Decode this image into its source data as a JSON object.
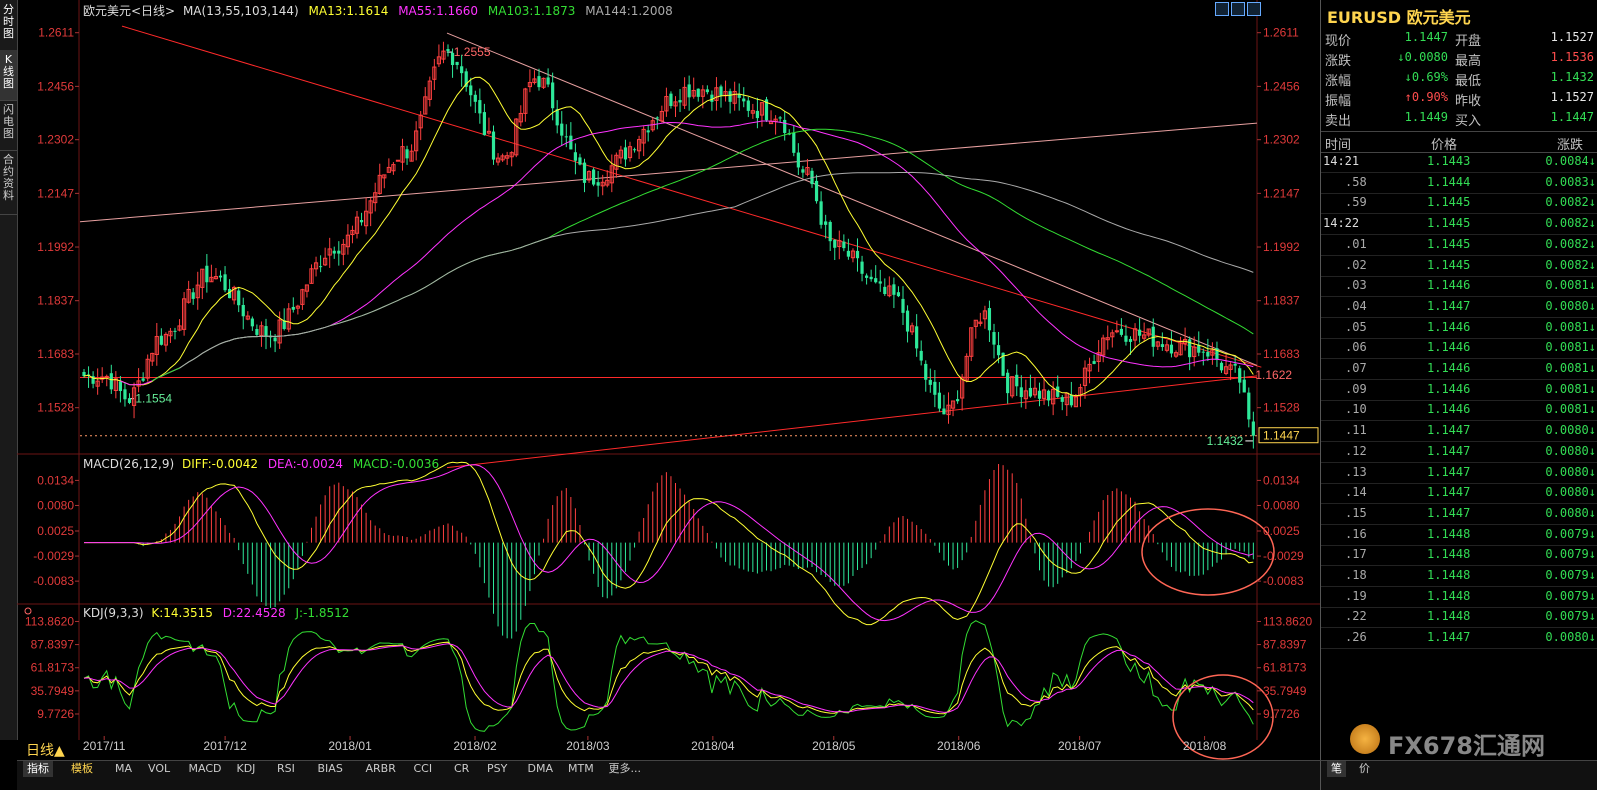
{
  "left_tabs": [
    "分时图",
    "K线图",
    "闪电图",
    "合约资料"
  ],
  "chart_header": {
    "symbol": "欧元美元<日线>",
    "ma_label": "MA(13,55,103,144)",
    "ma13": "MA13:1.1614",
    "ma55": "MA55:1.1660",
    "ma103": "MA103:1.1873",
    "ma144": "MA144:1.2008"
  },
  "macd_header": {
    "name": "MACD(26,12,9)",
    "diff": "DIFF:-0.0042",
    "dea": "DEA:-0.0024",
    "macd": "MACD:-0.0036"
  },
  "kdj_header": {
    "name": "KDJ(9,3,3)",
    "k": "K:14.3515",
    "d": "D:22.4528",
    "j": "J:-1.8512"
  },
  "period_label": "日线▲",
  "annotations": {
    "high": "1.2555",
    "low_left": "1.1554",
    "recent_high": "1.1622",
    "recent_low": "1.1432",
    "current_price": "1.1447"
  },
  "colors": {
    "up": "#ff4040",
    "down": "#2ee89a",
    "ma13": "#ffff33",
    "ma55": "#ff33ff",
    "ma103": "#33dd33",
    "ma144": "#aaaaaa",
    "axis_text": "#e03a3a",
    "trendline": "#ff2a2a",
    "resistance": "#e8a0a0",
    "highlight_circle": "#ff6655"
  },
  "bottom_tabs": [
    "指标",
    "模板",
    "MA",
    "VOL",
    "MACD",
    "KDJ",
    "RSI",
    "BIAS",
    "ARBR",
    "CCI",
    "CR",
    "PSY",
    "DMA",
    "MTM",
    "更多..."
  ],
  "right_panel": {
    "title": "EURUSD 欧元美元",
    "quote": [
      {
        "l1": "现价",
        "v1": "1.1447",
        "c1": "dn",
        "l2": "开盘",
        "v2": "1.1527",
        "c2": "val"
      },
      {
        "l1": "涨跌",
        "v1": "↓0.0080",
        "c1": "dn",
        "l2": "最高",
        "v2": "1.1536",
        "c2": "up"
      },
      {
        "l1": "涨幅",
        "v1": "↓0.69%",
        "c1": "dn",
        "l2": "最低",
        "v2": "1.1432",
        "c2": "dn"
      },
      {
        "l1": "振幅",
        "v1": "↑0.90%",
        "c1": "up",
        "l2": "昨收",
        "v2": "1.1527",
        "c2": "val"
      },
      {
        "l1": "卖出",
        "v1": "1.1449",
        "c1": "dn",
        "l2": "买入",
        "v2": "1.1447",
        "c2": "dn"
      }
    ],
    "tick_header": [
      "时间",
      "价格",
      "涨跌"
    ],
    "ticks": [
      {
        "t": "14:21",
        "p": "1.1443",
        "c": "0.0084"
      },
      {
        "t": ".58",
        "p": "1.1444",
        "c": "0.0083"
      },
      {
        "t": ".59",
        "p": "1.1445",
        "c": "0.0082"
      },
      {
        "t": "14:22",
        "p": "1.1445",
        "c": "0.0082"
      },
      {
        "t": ".01",
        "p": "1.1445",
        "c": "0.0082"
      },
      {
        "t": ".02",
        "p": "1.1445",
        "c": "0.0082"
      },
      {
        "t": ".03",
        "p": "1.1446",
        "c": "0.0081"
      },
      {
        "t": ".04",
        "p": "1.1447",
        "c": "0.0080"
      },
      {
        "t": ".05",
        "p": "1.1446",
        "c": "0.0081"
      },
      {
        "t": ".06",
        "p": "1.1446",
        "c": "0.0081"
      },
      {
        "t": ".07",
        "p": "1.1446",
        "c": "0.0081"
      },
      {
        "t": ".09",
        "p": "1.1446",
        "c": "0.0081"
      },
      {
        "t": ".10",
        "p": "1.1446",
        "c": "0.0081"
      },
      {
        "t": ".11",
        "p": "1.1447",
        "c": "0.0080"
      },
      {
        "t": ".12",
        "p": "1.1447",
        "c": "0.0080"
      },
      {
        "t": ".13",
        "p": "1.1447",
        "c": "0.0080"
      },
      {
        "t": ".14",
        "p": "1.1447",
        "c": "0.0080"
      },
      {
        "t": ".15",
        "p": "1.1447",
        "c": "0.0080"
      },
      {
        "t": ".16",
        "p": "1.1448",
        "c": "0.0079"
      },
      {
        "t": ".17",
        "p": "1.1448",
        "c": "0.0079"
      },
      {
        "t": ".18",
        "p": "1.1448",
        "c": "0.0079"
      },
      {
        "t": ".19",
        "p": "1.1448",
        "c": "0.0079"
      },
      {
        "t": ".22",
        "p": "1.1448",
        "c": "0.0079"
      },
      {
        "t": ".26",
        "p": "1.1447",
        "c": "0.0080"
      }
    ],
    "bottom_tabs": [
      "笔",
      "价"
    ]
  },
  "watermark": "FX678汇通网",
  "chart_data": [
    {
      "type": "candlestick",
      "title": "欧元美元<日线>",
      "y_ticks": [
        1.2611,
        1.2456,
        1.2302,
        1.2147,
        1.1992,
        1.1837,
        1.1683,
        1.1528
      ],
      "ylim": [
        1.14,
        1.2665
      ],
      "x_ticks": [
        "2017/11",
        "2017/12",
        "2018/01",
        "2018/02",
        "2018/03",
        "2018/04",
        "2018/05",
        "2018/06",
        "2018/07",
        "2018/08"
      ],
      "close_path": [
        {
          "x": "2017/11/01",
          "y": 1.162
        },
        {
          "x": "2017/11/07",
          "y": 1.1554
        },
        {
          "x": "2017/11/15",
          "y": 1.173
        },
        {
          "x": "2017/11/27",
          "y": 1.191
        },
        {
          "x": "2017/12/12",
          "y": 1.174
        },
        {
          "x": "2017/12/29",
          "y": 1.2
        },
        {
          "x": "2018/01/15",
          "y": 1.227
        },
        {
          "x": "2018/01/25",
          "y": 1.2555
        },
        {
          "x": "2018/02/08",
          "y": 1.225
        },
        {
          "x": "2018/02/16",
          "y": 1.248
        },
        {
          "x": "2018/03/01",
          "y": 1.219
        },
        {
          "x": "2018/03/27",
          "y": 1.245
        },
        {
          "x": "2018/04/17",
          "y": 1.238
        },
        {
          "x": "2018/04/24",
          "y": 1.22
        },
        {
          "x": "2018/05/01",
          "y": 1.199
        },
        {
          "x": "2018/05/15",
          "y": 1.185
        },
        {
          "x": "2018/05/29",
          "y": 1.151
        },
        {
          "x": "2018/06/07",
          "y": 1.18
        },
        {
          "x": "2018/06/14",
          "y": 1.159
        },
        {
          "x": "2018/06/28",
          "y": 1.155
        },
        {
          "x": "2018/07/09",
          "y": 1.175
        },
        {
          "x": "2018/07/31",
          "y": 1.17
        },
        {
          "x": "2018/08/09",
          "y": 1.1622
        },
        {
          "x": "2018/08/13",
          "y": 1.1447
        }
      ],
      "moving_averages": [
        {
          "name": "MA13",
          "last": 1.1614
        },
        {
          "name": "MA55",
          "last": 1.166
        },
        {
          "name": "MA103",
          "last": 1.1873
        },
        {
          "name": "MA144",
          "last": 1.2008
        }
      ]
    },
    {
      "type": "line",
      "title": "MACD(26,12,9)",
      "y_ticks": [
        0.0134,
        0.008,
        0.0025,
        -0.0029,
        -0.0083
      ],
      "ylim": [
        -0.0115,
        0.0165
      ],
      "series": [
        {
          "name": "DIFF",
          "last": -0.0042
        },
        {
          "name": "DEA",
          "last": -0.0024
        },
        {
          "name": "MACD",
          "last": -0.0036
        }
      ]
    },
    {
      "type": "line",
      "title": "KDJ(9,3,3)",
      "y_ticks": [
        113.862,
        87.8397,
        61.8173,
        35.7949,
        9.7726
      ],
      "ylim": [
        -15,
        120
      ],
      "series": [
        {
          "name": "K",
          "last": 14.3515
        },
        {
          "name": "D",
          "last": 22.4528
        },
        {
          "name": "J",
          "last": -1.8512
        }
      ]
    }
  ]
}
